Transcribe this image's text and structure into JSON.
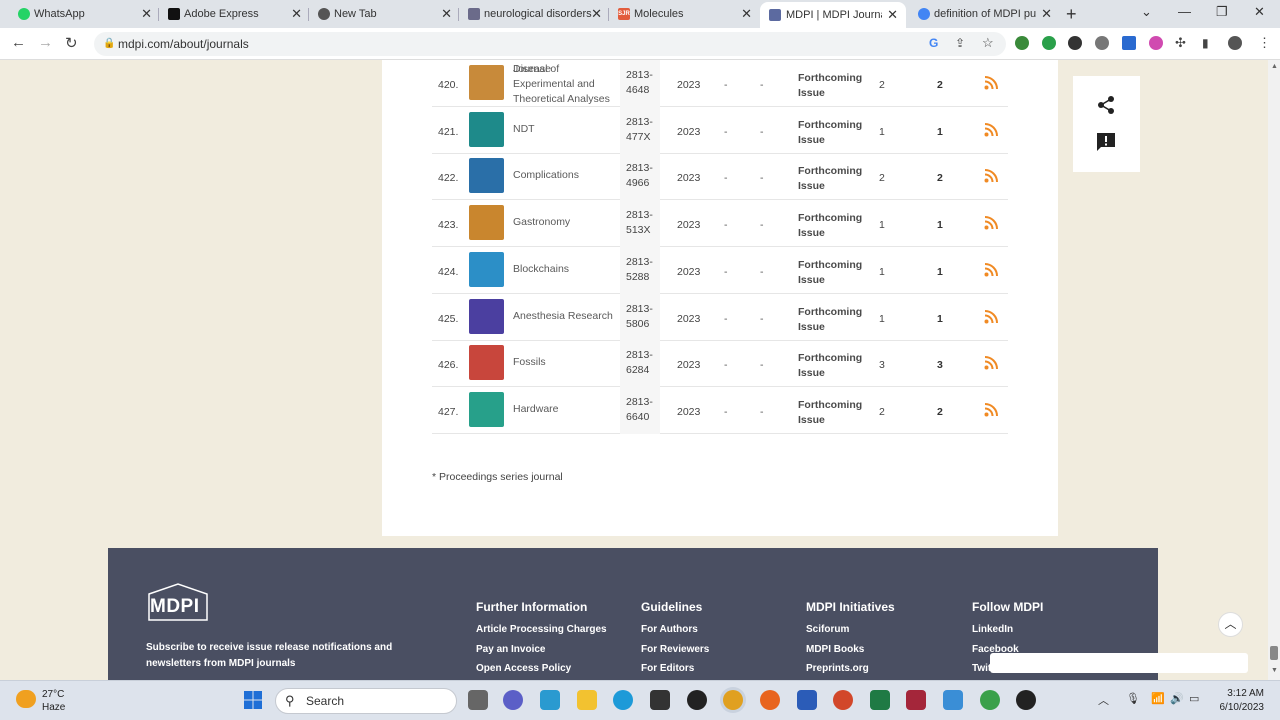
{
  "browser": {
    "tabs": [
      {
        "title": "WhatsApp",
        "favicon_color": "#25d366"
      },
      {
        "title": "Adobe Express",
        "favicon_color": "#111111"
      },
      {
        "title": "New Tab",
        "favicon_color": "#555555"
      },
      {
        "title": "neurological disorders",
        "favicon_color": "#6b6b8a"
      },
      {
        "title": "Molecules",
        "favicon_color": "#e25c3c",
        "favicon_text": "SJR"
      },
      {
        "title": "MDPI | MDPI Journal",
        "favicon_color": "#5c6aa0",
        "active": true
      },
      {
        "title": "definition of MDPI pu",
        "favicon_color": "#4285f4"
      }
    ],
    "new_tab_symbol": "+",
    "url": "mdpi.com/about/journals"
  },
  "table": {
    "partial_row_name": "Disease",
    "rows": [
      {
        "num": "420.",
        "name": "Journal of Experimental and Theoretical Analyses",
        "issn": "2813-4648",
        "year": "2023",
        "d1": "-",
        "d2": "-",
        "status": "Forthcoming Issue",
        "c1": "2",
        "c2": "2",
        "logo_color": "#c88a3a"
      },
      {
        "num": "421.",
        "name": "NDT",
        "issn": "2813-477X",
        "year": "2023",
        "d1": "-",
        "d2": "-",
        "status": "Forthcoming Issue",
        "c1": "1",
        "c2": "1",
        "logo_color": "#1e8a8a"
      },
      {
        "num": "422.",
        "name": "Complications",
        "issn": "2813-4966",
        "year": "2023",
        "d1": "-",
        "d2": "-",
        "status": "Forthcoming Issue",
        "c1": "2",
        "c2": "2",
        "logo_color": "#2a6fa8"
      },
      {
        "num": "423.",
        "name": "Gastronomy",
        "issn": "2813-513X",
        "year": "2023",
        "d1": "-",
        "d2": "-",
        "status": "Forthcoming Issue",
        "c1": "1",
        "c2": "1",
        "logo_color": "#c9862e"
      },
      {
        "num": "424.",
        "name": "Blockchains",
        "issn": "2813-5288",
        "year": "2023",
        "d1": "-",
        "d2": "-",
        "status": "Forthcoming Issue",
        "c1": "1",
        "c2": "1",
        "logo_color": "#2c8fc7"
      },
      {
        "num": "425.",
        "name": "Anesthesia Research",
        "issn": "2813-5806",
        "year": "2023",
        "d1": "-",
        "d2": "-",
        "status": "Forthcoming Issue",
        "c1": "1",
        "c2": "1",
        "logo_color": "#4b3fa0"
      },
      {
        "num": "426.",
        "name": "Fossils",
        "issn": "2813-6284",
        "year": "2023",
        "d1": "-",
        "d2": "-",
        "status": "Forthcoming Issue",
        "c1": "3",
        "c2": "3",
        "logo_color": "#c8463c"
      },
      {
        "num": "427.",
        "name": "Hardware",
        "issn": "2813-6640",
        "year": "2023",
        "d1": "-",
        "d2": "-",
        "status": "Forthcoming Issue",
        "c1": "2",
        "c2": "2",
        "logo_color": "#27a08a"
      }
    ],
    "rss_icon": "rss-icon",
    "rss_color": "#f08a24"
  },
  "note": "* Proceedings series journal",
  "sidebar_actions": {
    "share_icon": "share-icon",
    "feedback_icon": "feedback-icon"
  },
  "footer": {
    "logo_text": "MDPI",
    "subscribe_text": "Subscribe to receive issue release notifications and newsletters from MDPI journals",
    "columns": [
      {
        "heading": "Further Information",
        "links": [
          "Article Processing Charges",
          "Pay an Invoice",
          "Open Access Policy"
        ]
      },
      {
        "heading": "Guidelines",
        "links": [
          "For Authors",
          "For Reviewers",
          "For Editors"
        ]
      },
      {
        "heading": "MDPI Initiatives",
        "links": [
          "Sciforum",
          "MDPI Books",
          "Preprints.org"
        ]
      },
      {
        "heading": "Follow MDPI",
        "links": [
          "LinkedIn",
          "Facebook",
          "Twitter"
        ]
      }
    ],
    "background": "#4a4f62"
  },
  "taskbar": {
    "weather_temp": "27°C",
    "weather_desc": "Haze",
    "search_label": "Search",
    "time": "3:12 AM",
    "date": "6/10/2023"
  }
}
